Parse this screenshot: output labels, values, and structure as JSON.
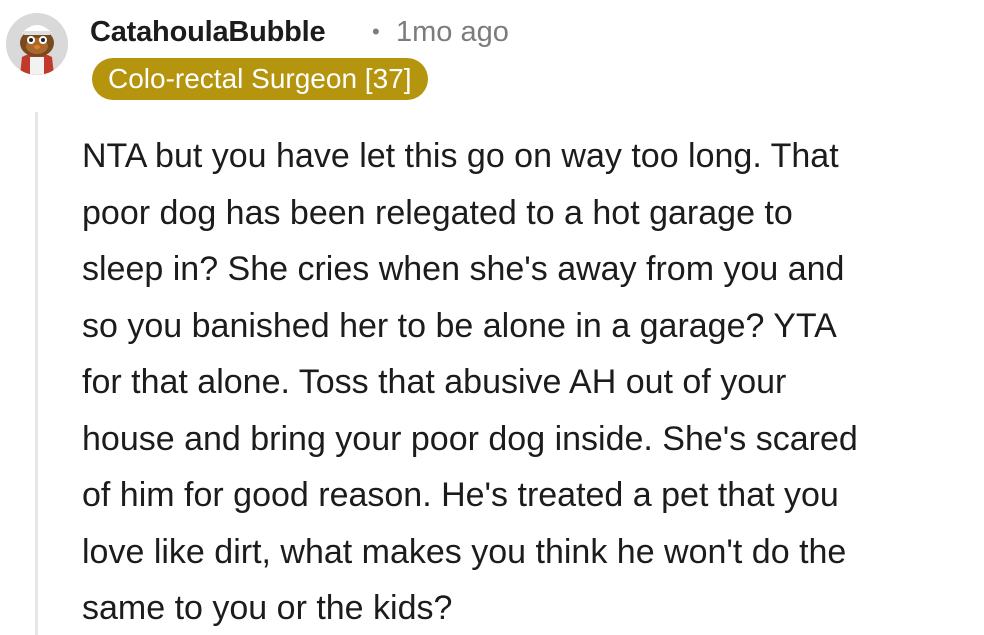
{
  "comment": {
    "author": "CatahoulaBubble",
    "separator": "•",
    "timestamp": "1mo ago",
    "flair": "Colo-rectal Surgeon [37]",
    "flair_color": "#b5940e",
    "avatar_icon": "snoo-avatar-icon",
    "body": "NTA but you have let this go on way too long. That\npoor dog has been relegated to a hot garage to\nsleep in? She cries when she's away from you and\nso you banished her to be alone in a garage? YTA\nfor that alone. Toss that abusive AH out of your\nhouse and bring your poor dog inside. She's scared\nof him for good reason. He's treated a pet that you\nlove like dirt, what makes you think he won't do the\nsame to you or the kids?"
  }
}
